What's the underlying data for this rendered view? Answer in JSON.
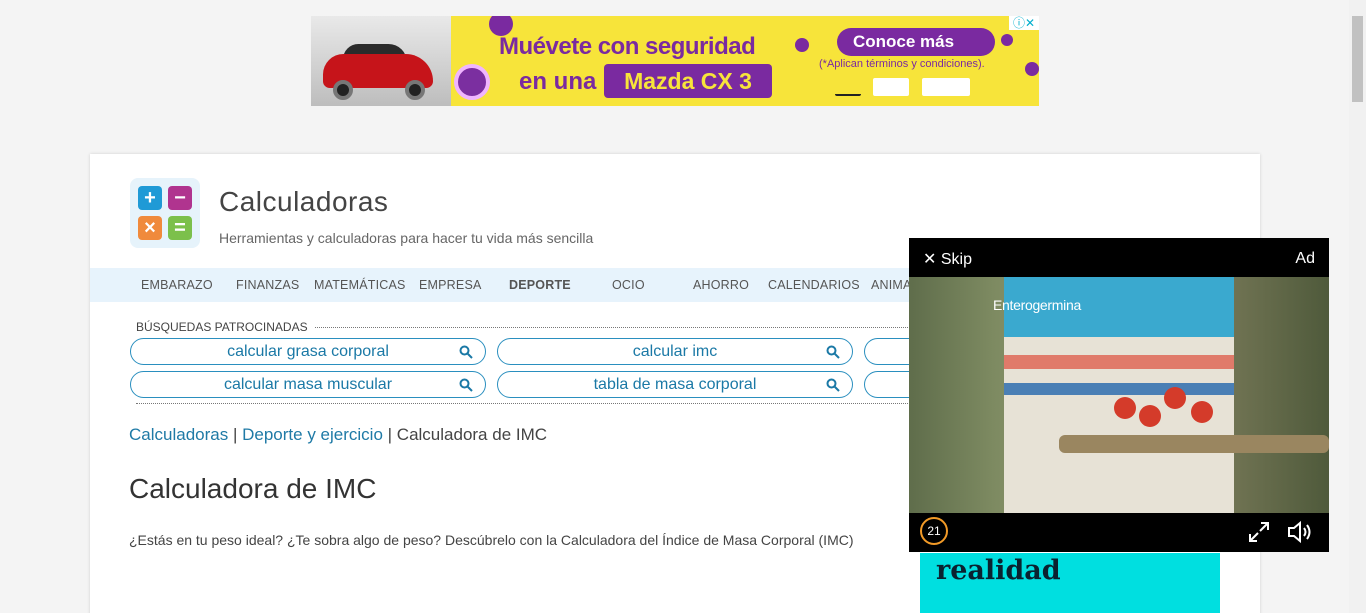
{
  "top_ad": {
    "headline_1": "Muévete con seguridad",
    "headline_2": "en una",
    "model": "Mazda CX 3",
    "cta": "Conoce más",
    "terms": "(*Aplican términos y condiciones).",
    "brand_color": "#7a2aa0",
    "bg_color": "#f7e43a"
  },
  "site": {
    "title": "Calculadoras",
    "tagline": "Herramientas y calculadoras para hacer tu vida más sencilla"
  },
  "nav": {
    "items": [
      "EMBARAZO",
      "FINANZAS",
      "MATEMÁTICAS",
      "EMPRESA",
      "DEPORTE",
      "OCIO",
      "AHORRO",
      "CALENDARIOS",
      "ANIMA"
    ],
    "active": "DEPORTE"
  },
  "sponsored": {
    "label": "BÚSQUEDAS PATROCINADAS",
    "searches": [
      "calcular grasa corporal",
      "calcular imc",
      "calcular masa muscular",
      "tabla de masa corporal"
    ]
  },
  "breadcrumb": {
    "home": "Calculadoras",
    "sep": "|",
    "category": "Deporte y ejercicio",
    "current": "Calculadora de IMC"
  },
  "page": {
    "title": "Calculadora de IMC",
    "intro": "¿Estás en tu peso ideal? ¿Te sobra algo de peso? Descúbrelo con la Calculadora del Índice de Masa Corporal (IMC)"
  },
  "video_ad": {
    "skip_label": "Skip",
    "ad_label": "Ad",
    "brand": "Enterogermina",
    "countdown": "21"
  },
  "side_ad": {
    "text": "realidad"
  }
}
